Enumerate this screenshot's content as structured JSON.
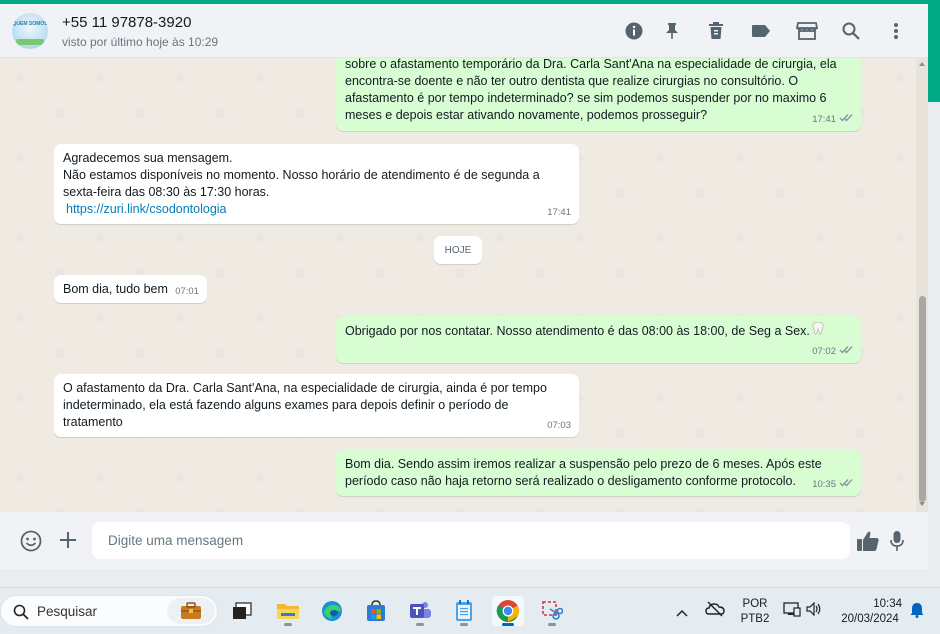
{
  "header": {
    "contact_name": "+55 11 97878-3920",
    "status": "visto por último hoje às 10:29",
    "avatar_text": "QUEM SOMOS",
    "icons": [
      "info-icon",
      "pin-icon",
      "delete-icon",
      "label-icon",
      "store-icon",
      "search-icon",
      "more-vertical-icon"
    ]
  },
  "chat": {
    "day_chip": "HOJE",
    "messages": [
      {
        "dir": "out",
        "text": "sobre o afastamento temporário da Dra. Carla Sant'Ana na especialidade de cirurgia, ela\nencontra-se doente e não ter outro dentista que realize cirurgias no consultório. O\nafastamento é por tempo indeterminado? se sim podemos suspender por no maximo 6\nmeses e depois estar ativando novamente, podemos prosseguir?",
        "time": "17:41",
        "ticks": "read"
      },
      {
        "dir": "in",
        "text": "Agradecemos sua mensagem.\nNão estamos disponíveis no momento. Nosso horário de atendimento é de segunda a\nsexta-feira das 08:30 às 17:30 horas.",
        "link": "https://zuri.link/csodontologia",
        "time": "17:41"
      },
      {
        "dir": "in",
        "text": "Bom dia, tudo bem",
        "time": "07:01"
      },
      {
        "dir": "out",
        "text": "Obrigado por nos contatar. Nosso atendimento é das 08:00 às 18:00, de Seg a Sex.",
        "emoji": "tooth-emoji",
        "time": "07:02",
        "ticks": "read"
      },
      {
        "dir": "in",
        "text": "O afastamento da Dra. Carla Sant'Ana, na especialidade de cirurgia, ainda é por tempo\nindeterminado, ela está fazendo alguns exames para depois definir o período de\ntratamento",
        "time": "07:03"
      },
      {
        "dir": "out",
        "text": "Bom dia. Sendo assim iremos realizar a suspensão pelo prezo de 6 meses. Após este\nperíodo caso não haja retorno será realizado o desligamento conforme protocolo.",
        "time": "10:35",
        "ticks": "read"
      }
    ]
  },
  "composer": {
    "placeholder": "Digite uma mensagem",
    "icons": [
      "emoji-icon",
      "plus-icon",
      "thumbs-up-icon",
      "microphone-icon"
    ]
  },
  "taskbar": {
    "search_label": "Pesquisar",
    "apps": [
      "briefcase-icon",
      "task-view-icon",
      "file-explorer-icon",
      "edge-icon",
      "store-icon",
      "teams-icon",
      "notepad-icon",
      "chrome-icon",
      "snipping-tool-icon"
    ],
    "lang": "POR",
    "layout": "PTB2",
    "time": "10:34",
    "date": "20/03/2024"
  },
  "colors": {
    "accent": "#00a884",
    "outgoing_bubble": "#d9fdd3",
    "incoming_bubble": "#ffffff",
    "chat_bg": "#efeae2",
    "read_ticks": "#8696a0",
    "link": "#027eb5"
  }
}
